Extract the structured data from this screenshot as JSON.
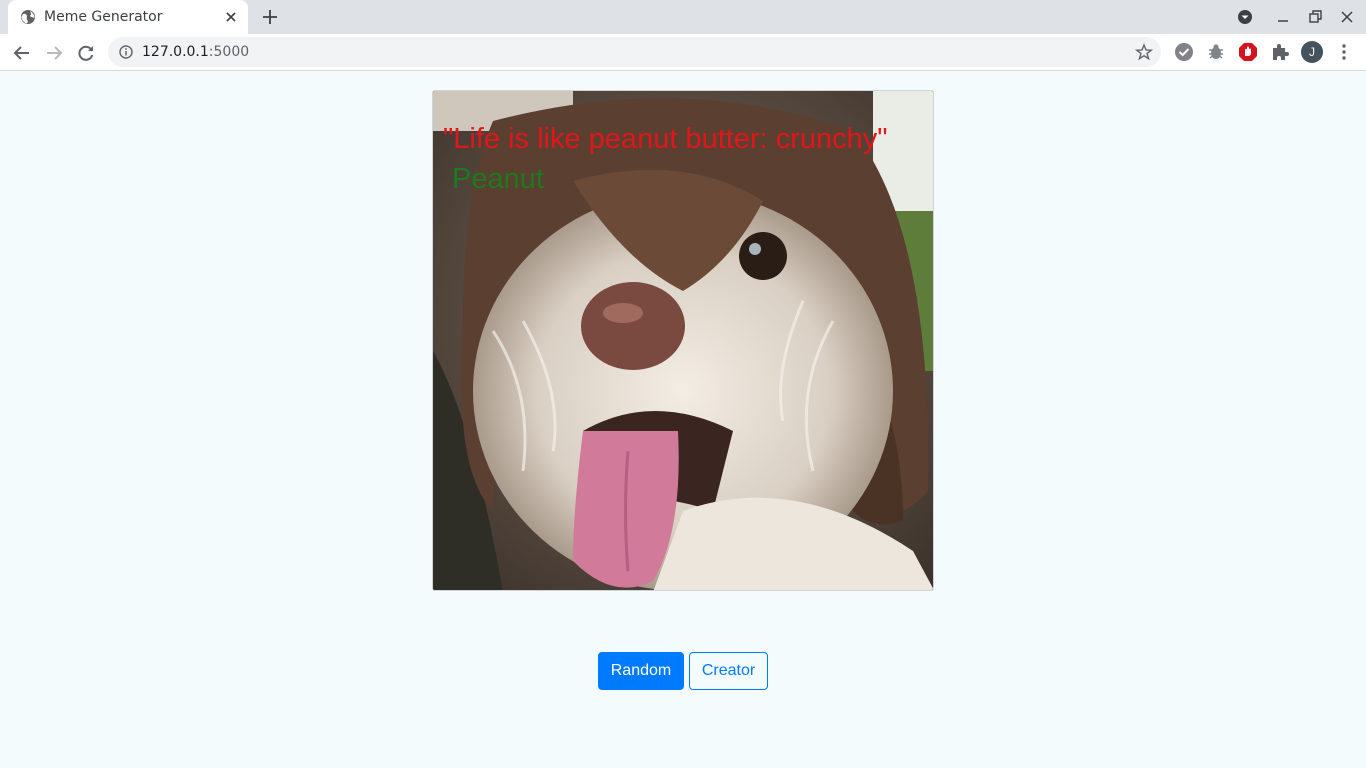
{
  "browser": {
    "tab_title": "Meme Generator",
    "url_host": "127.0.0.1",
    "url_port": ":5000",
    "profile_initial": "J"
  },
  "meme": {
    "quote": "\"Life is like peanut butter: crunchy\"",
    "author": "Peanut",
    "quote_color": "#e0161b",
    "author_color": "#1d7a1d"
  },
  "buttons": {
    "random_label": "Random",
    "creator_label": "Creator",
    "accent": "#007bff"
  },
  "icons": {
    "favicon": "globe-icon",
    "extensions": [
      "check-circle-icon",
      "bug-icon",
      "shield-icon",
      "puzzle-icon"
    ]
  }
}
